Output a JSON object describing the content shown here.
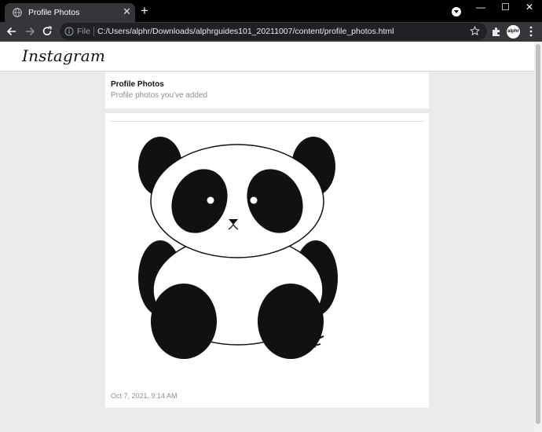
{
  "browser": {
    "tab_title": "Profile Photos",
    "tab_close": "✕",
    "new_tab": "+",
    "file_label": "File",
    "url": "C:/Users/alphr/Downloads/alphrguides101_20211007/content/profile_photos.html",
    "avatar_text": "alphr",
    "window_controls": {
      "minimize": "—",
      "maximize": "☐",
      "close": "✕"
    }
  },
  "page": {
    "logo": "Instagram",
    "section_title": "Profile Photos",
    "section_subtitle": "Profile photos you've added",
    "photo_timestamp": "Oct 7, 2021, 9:14 AM"
  },
  "icons": {
    "tab": "globe-icon",
    "toolbar": [
      "back-icon",
      "forward-icon",
      "reload-icon",
      "info-icon",
      "star-icon",
      "extensions-icon",
      "menu-icon"
    ]
  }
}
